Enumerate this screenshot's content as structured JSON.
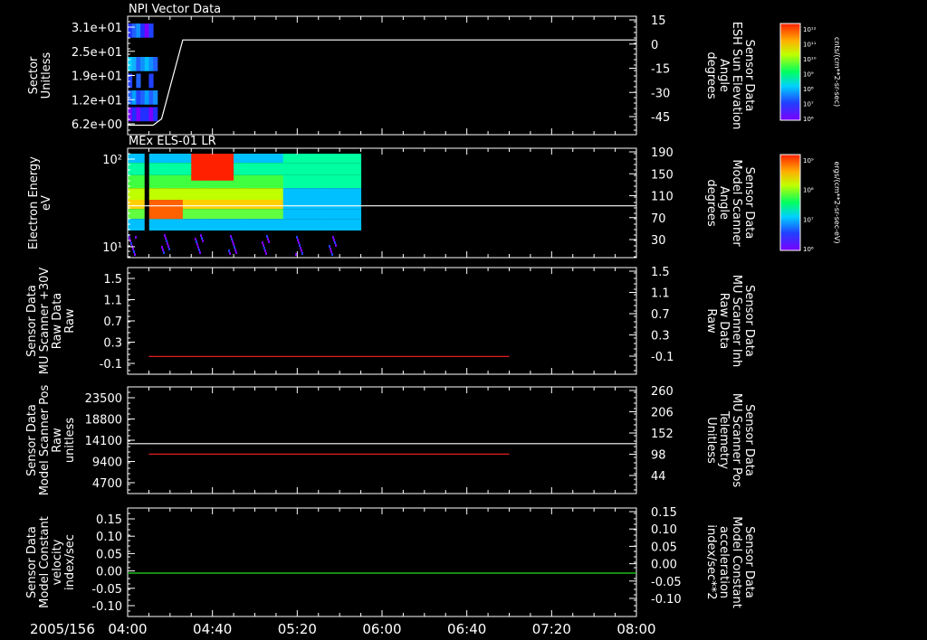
{
  "colors": {
    "background": "#000000",
    "axis": "#ffffff",
    "red_trace": "#ff2020",
    "green_trace": "#20e020",
    "white_trace": "#ffffff"
  },
  "chart_data": [
    {
      "type": "heatmap",
      "title": "NPI Vector Data",
      "ylabel": [
        "Sector",
        "Unitless"
      ],
      "ylabel_color": "#ffffff",
      "yticks": [
        "3.1e+01",
        "2.5e+01",
        "1.9e+01",
        "1.2e+01",
        "6.2e+00"
      ],
      "ylim": [
        0,
        31
      ],
      "right_ylabel": [
        "Sensor Data",
        "ESH Sun Elevation",
        "Angle",
        "degrees"
      ],
      "right_ylabel_color": "#ffffff",
      "right_yticks": [
        15,
        0,
        -15,
        -30,
        -45
      ],
      "right_ylim": [
        -60,
        15
      ],
      "heatmap_time_range": [
        "04:00",
        "04:16"
      ],
      "colorbar": {
        "label": "NF",
        "units": "cnts/(cm**2-sr-sec)",
        "ticks": [
          "10¹²",
          "10¹¹",
          "10¹⁰",
          "10⁹",
          "10⁸",
          "10⁷",
          "10⁶"
        ]
      },
      "series": [
        {
          "color": "#ffffff",
          "axis": "right",
          "x": [
            "04:00",
            "04:12",
            "04:16",
            "04:20",
            "04:26",
            "07:30",
            "08:00"
          ],
          "values": [
            -54,
            -54,
            -50,
            -30,
            0,
            0,
            0
          ]
        }
      ]
    },
    {
      "type": "heatmap",
      "title": "MEx ELS-01 LR",
      "ylabel": [
        "Electron Energy",
        "eV"
      ],
      "ylabel_color": "#ffffff",
      "yticks": [
        "10²",
        "10¹"
      ],
      "y_scale": "log",
      "right_ylabel": [
        "Sensor Data",
        "Model Scanner",
        "Angle",
        "degrees"
      ],
      "right_ylabel_color": "#ffffff",
      "right_yticks": [
        190,
        150,
        110,
        70,
        30
      ],
      "right_ylim": [
        0,
        190
      ],
      "heatmap_time_range": [
        "04:00",
        "05:50"
      ],
      "colorbar": {
        "label": "DEF",
        "units": "ergs/(cm**2-sr-sec-eV)",
        "ticks": [
          "10⁹",
          "10⁸",
          "10⁷",
          "10⁶"
        ]
      },
      "series": [
        {
          "color": "#ffffff",
          "axis": "right",
          "x": [
            "04:00",
            "08:00"
          ],
          "values": [
            90,
            90
          ]
        }
      ]
    },
    {
      "type": "line",
      "ylabel": [
        "Sensor Data",
        "MU Scanner +30V",
        "Raw Data",
        "Raw"
      ],
      "ylabel_color": "#ffffff",
      "yticks": [
        "1.5",
        "1.1",
        "0.7",
        "0.3",
        "-0.1"
      ],
      "ylim": [
        -0.3,
        1.5
      ],
      "right_ylabel": [
        "Sensor Data",
        "MU Scanner Inh",
        "Raw Data",
        "Raw"
      ],
      "right_ylabel_color": "#ff2020",
      "right_yticks": [
        "1.5",
        "1.1",
        "0.7",
        "0.3",
        "-0.1"
      ],
      "right_ylim": [
        -0.3,
        1.5
      ],
      "series": [
        {
          "color": "#ff2020",
          "axis": "right",
          "x": [
            "04:10",
            "07:00"
          ],
          "values": [
            0,
            0
          ]
        }
      ]
    },
    {
      "type": "line",
      "ylabel": [
        "Sensor Data",
        "Model Scanner Pos",
        "Raw",
        "unitless"
      ],
      "ylabel_color": "#ffffff",
      "yticks": [
        "23500",
        "18800",
        "14100",
        "9400",
        "4700"
      ],
      "ylim": [
        0,
        23500
      ],
      "right_ylabel": [
        "Sensor Data",
        "MU Scanner Pos",
        "Telemetry",
        "Unitless"
      ],
      "right_ylabel_color": "#ff2020",
      "right_yticks": [
        "260",
        "206",
        "152",
        "98",
        "44"
      ],
      "right_ylim": [
        -10,
        260
      ],
      "series": [
        {
          "color": "#ffffff",
          "axis": "left",
          "x": [
            "04:00",
            "08:00"
          ],
          "values": [
            11000,
            11000
          ]
        },
        {
          "color": "#ff2020",
          "axis": "right",
          "x": [
            "04:10",
            "07:00"
          ],
          "values": [
            90,
            90
          ]
        }
      ]
    },
    {
      "type": "line",
      "ylabel": [
        "Sensor Data",
        "Model Constant",
        "velocity",
        "index/sec"
      ],
      "ylabel_color": "#ffffff",
      "yticks": [
        "0.15",
        "0.10",
        "0.05",
        "0.00",
        "-0.05",
        "-0.10"
      ],
      "ylim": [
        -0.1,
        0.15
      ],
      "right_ylabel": [
        "Sensor Data",
        "Model Constant",
        "acceleration",
        "index/sec**2"
      ],
      "right_ylabel_color": "#20e020",
      "right_yticks": [
        "0.15",
        "0.10",
        "0.05",
        "0.00",
        "-0.05",
        "-0.10"
      ],
      "right_ylim": [
        -0.1,
        0.15
      ],
      "series": [
        {
          "color": "#20e020",
          "axis": "right",
          "x": [
            "04:00",
            "08:00"
          ],
          "values": [
            0,
            0
          ]
        }
      ]
    }
  ],
  "x_axis": {
    "date_label": "2005/156",
    "ticks": [
      "04:00",
      "04:40",
      "05:20",
      "06:00",
      "06:40",
      "07:20",
      "08:00"
    ],
    "range": [
      "04:00",
      "08:00"
    ]
  }
}
